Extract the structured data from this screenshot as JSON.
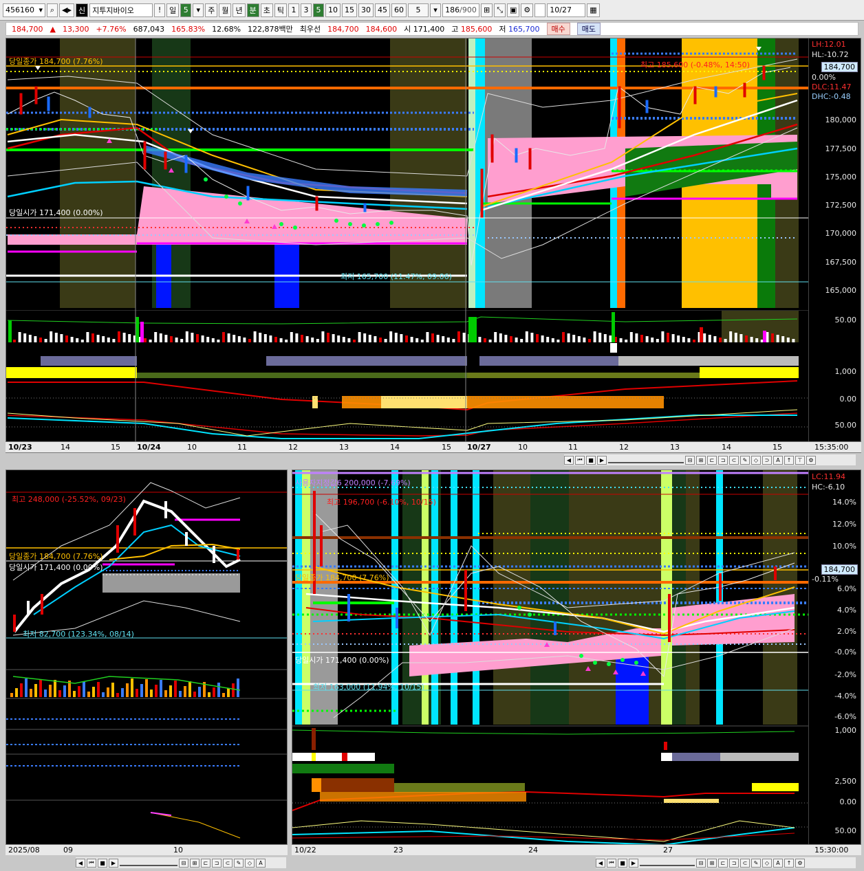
{
  "toolbar": {
    "code": "456160",
    "shin": "신",
    "name": "지투지바이오",
    "alert": "!",
    "il": "일",
    "il_num": "5",
    "periods": [
      "주",
      "월",
      "년",
      "분",
      "초",
      "틱"
    ],
    "intervals": [
      "1",
      "3",
      "5",
      "10",
      "15",
      "30",
      "45",
      "60"
    ],
    "sel_interval": "5",
    "count": "186",
    "count_max": "/900",
    "date": "10/27"
  },
  "quote": {
    "price": "184,700",
    "change_arrow": "▲",
    "change": "13,300",
    "change_pct": "+7.76%",
    "volume": "687,043",
    "vol_ratio": "165.83%",
    "turnover": "12.68%",
    "amount": "122,878백만",
    "best_label": "최우선",
    "best_ask": "184,700",
    "best_bid": "184,600",
    "open_label": "시",
    "open": "171,400",
    "high_label": "고",
    "high": "185,600",
    "low_label": "저",
    "low": "165,700",
    "buy": "매수",
    "sell": "매도"
  },
  "top_chart": {
    "close_label": "당일종가 184,700 (7.76%)",
    "open_label": "당일시가 171,400 (0.00%)",
    "high_label": "최고 185,600 (-0.48%, 14:50)",
    "low_label": "최저 165,700 (11.47%, 09:06)",
    "right_labels": [
      "LH:12.01",
      "HL:-10.72",
      "184,700",
      "0.00%",
      "DLC:11.47",
      "DHC:-0.48"
    ],
    "y_ticks": [
      "180,000",
      "177,500",
      "175,000",
      "172,500",
      "170,000",
      "167,500",
      "165,000"
    ],
    "vol_ticks": [
      "50.00"
    ],
    "ind_ticks": [
      "1,000",
      "0.00",
      "50.00"
    ],
    "x_labels": [
      "10/23",
      "14",
      "15",
      "10/24",
      "10",
      "11",
      "12",
      "13",
      "14",
      "15",
      "10/27",
      "10",
      "11",
      "12",
      "13",
      "14",
      "15"
    ],
    "time": "15:35:00"
  },
  "bottom_left": {
    "high_label": "최고 248,000 (-25.52%, 09/23)",
    "close_label": "당일종가 184,700 (7.76%)",
    "open_label": "당일시가 171,400 (0.00%)",
    "low_label": "최저 82,700 (123.34%, 08/14)",
    "x_labels": [
      "2025/08",
      "09",
      "10"
    ]
  },
  "bottom_right": {
    "top_label": "사용자지정값6 200,000 (-7.69%)",
    "high_label": "최고 196,700 (-6.10%, 10/15)",
    "close_label": "당일종가 184,700 (7.76%)",
    "open_label": "당일시가 171,400 (0.00%)",
    "low_label": "최저 163,000 (11.94%, 10/15)",
    "right_labels": [
      "LC:11.94",
      "HC:-6.10",
      "184,700",
      "-0.11%"
    ],
    "y_ticks": [
      "14.0%",
      "12.0%",
      "10.0%",
      "6.0%",
      "4.0%",
      "2.0%",
      "-0.0%",
      "-2.0%",
      "-4.0%",
      "-6.0%"
    ],
    "ind_ticks": [
      "1,000",
      "2,500",
      "0.00",
      "50.00"
    ],
    "x_labels": [
      "10/22",
      "23",
      "24",
      "27"
    ],
    "time": "15:30:00"
  },
  "colors": {
    "up": "#e00000",
    "down": "#1a2bd6",
    "pink_band": "#ff9ecf",
    "orange_line": "#ff6a00",
    "gold": "#ffc000",
    "cyan": "#00e5ff"
  }
}
